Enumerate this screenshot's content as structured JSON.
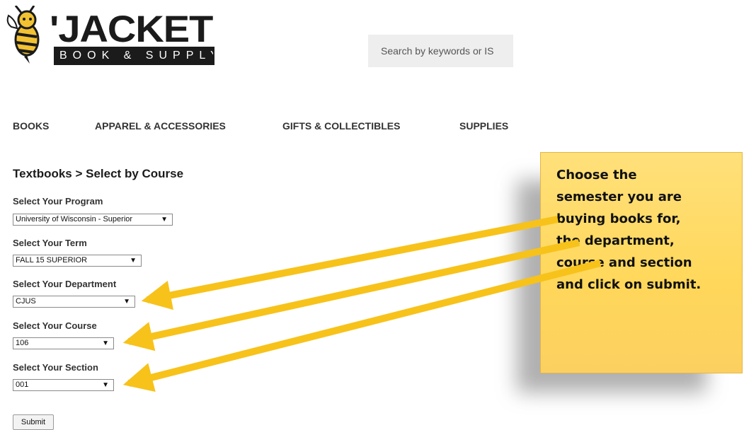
{
  "header": {
    "logo_word": "'JACKET",
    "logo_tagline": "BOOK & SUPPLY",
    "search_placeholder": "Search by keywords or IS"
  },
  "nav": {
    "items": [
      {
        "label": "BOOKS"
      },
      {
        "label": "APPAREL & ACCESSORIES"
      },
      {
        "label": "GIFTS & COLLECTIBLES"
      },
      {
        "label": "SUPPLIES"
      }
    ]
  },
  "breadcrumb": "Textbooks > Select by Course",
  "form": {
    "program": {
      "label": "Select Your Program",
      "value": "University of Wisconsin - Superior"
    },
    "term": {
      "label": "Select Your Term",
      "value": "FALL 15 SUPERIOR"
    },
    "department": {
      "label": "Select Your Department",
      "value": "CJUS"
    },
    "course": {
      "label": "Select Your Course",
      "value": "106"
    },
    "section": {
      "label": "Select Your Section",
      "value": "001"
    },
    "submit_label": "Submit"
  },
  "callout": {
    "lines": [
      "Choose the",
      "semester you are",
      "buying books for,",
      "the department,",
      "course and section",
      "and click on submit."
    ]
  },
  "colors": {
    "callout": "#ffd75a",
    "arrow": "#f7c21a",
    "logo": "#1b1b1b"
  }
}
